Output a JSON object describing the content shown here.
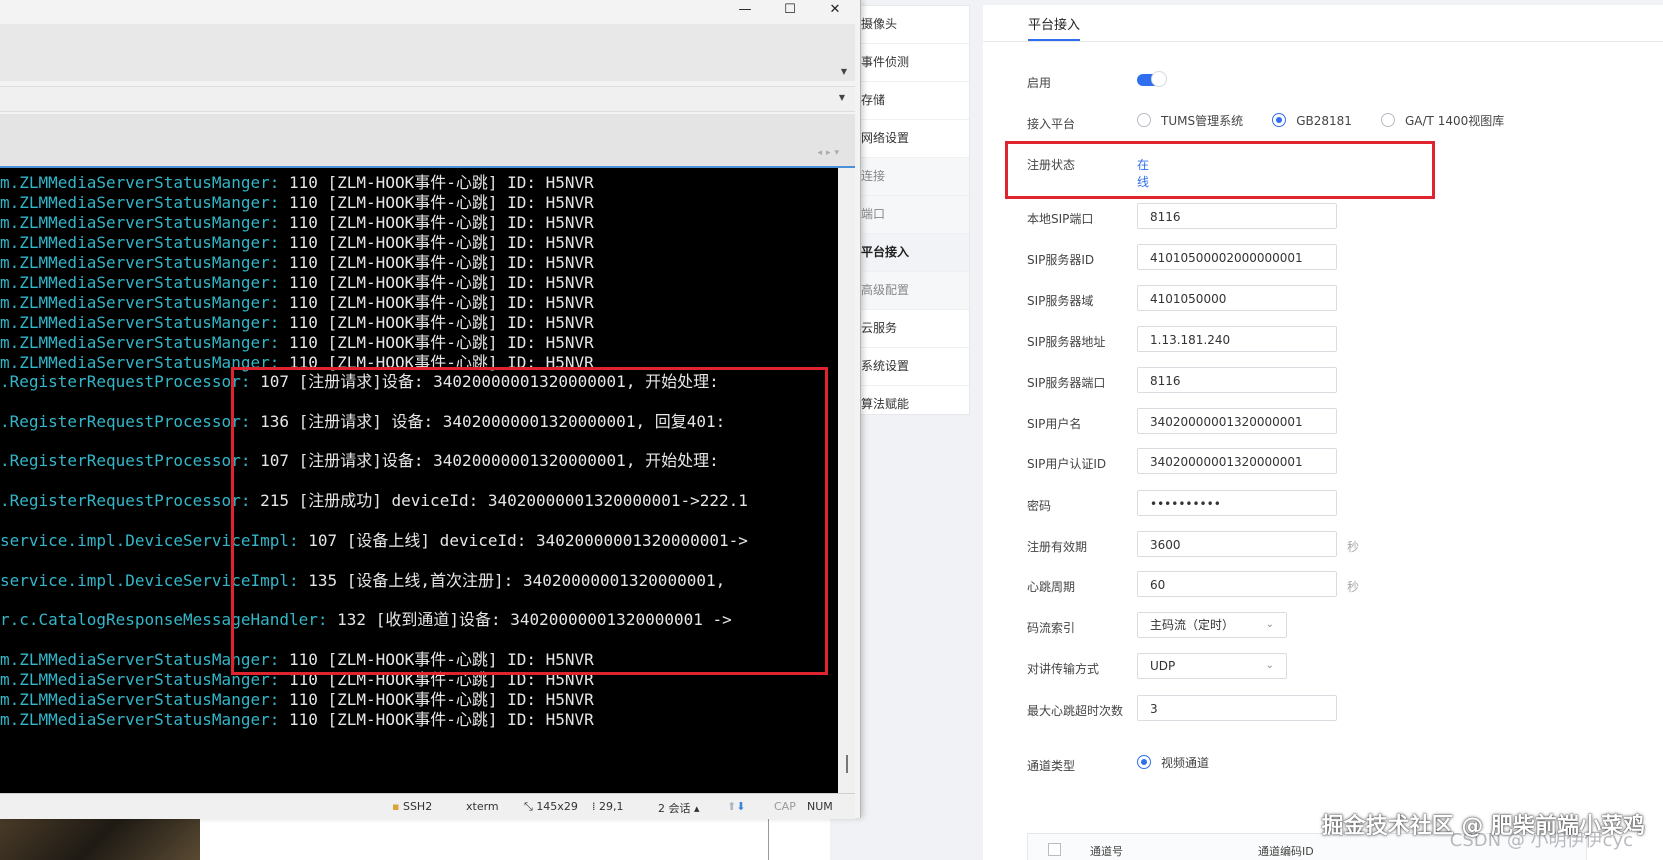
{
  "terminal": {
    "title_buttons": {
      "minimize": "—",
      "maximize": "☐",
      "close": "✕"
    },
    "lines": [
      {
        "source": "m.ZLMMediaServerStatusManger",
        "sep": ": ",
        "msg": "110 [ZLM-HOOK事件-心跳] ID: H5NVR"
      },
      {
        "source": "m.ZLMMediaServerStatusManger",
        "sep": ": ",
        "msg": "110 [ZLM-HOOK事件-心跳] ID: H5NVR"
      },
      {
        "source": "m.ZLMMediaServerStatusManger",
        "sep": ": ",
        "msg": "110 [ZLM-HOOK事件-心跳] ID: H5NVR"
      },
      {
        "source": "m.ZLMMediaServerStatusManger",
        "sep": ": ",
        "msg": "110 [ZLM-HOOK事件-心跳] ID: H5NVR"
      },
      {
        "source": "m.ZLMMediaServerStatusManger",
        "sep": ": ",
        "msg": "110 [ZLM-HOOK事件-心跳] ID: H5NVR"
      },
      {
        "source": "m.ZLMMediaServerStatusManger",
        "sep": ": ",
        "msg": "110 [ZLM-HOOK事件-心跳] ID: H5NVR"
      },
      {
        "source": "m.ZLMMediaServerStatusManger",
        "sep": ": ",
        "msg": "110 [ZLM-HOOK事件-心跳] ID: H5NVR"
      },
      {
        "source": "m.ZLMMediaServerStatusManger",
        "sep": ": ",
        "msg": "110 [ZLM-HOOK事件-心跳] ID: H5NVR"
      },
      {
        "source": "m.ZLMMediaServerStatusManger",
        "sep": ": ",
        "msg": "110 [ZLM-HOOK事件-心跳] ID: H5NVR"
      },
      {
        "source": "m.ZLMMediaServerStatusManger",
        "sep": ": ",
        "msg": "110 [ZLM-HOOK事件-心跳] ID: H5NVR"
      },
      {
        "source": ".RegisterRequestProcessor",
        "sep": ": ",
        "msg": "107 [注册请求]设备: 34020000001320000001, 开始处理:"
      },
      {
        "source": ".RegisterRequestProcessor",
        "sep": ": ",
        "msg": "136 [注册请求] 设备: 34020000001320000001, 回复401:"
      },
      {
        "source": ".RegisterRequestProcessor",
        "sep": ": ",
        "msg": "107 [注册请求]设备: 34020000001320000001, 开始处理:"
      },
      {
        "source": ".RegisterRequestProcessor",
        "sep": ": ",
        "msg": "215 [注册成功] deviceId: 34020000001320000001->222.1"
      },
      {
        "source": "service.impl.DeviceServiceImpl",
        "sep": ": ",
        "msg": "107 [设备上线] deviceId: 34020000001320000001->"
      },
      {
        "source": "service.impl.DeviceServiceImpl",
        "sep": ": ",
        "msg": "135 [设备上线,首次注册]: 34020000001320000001,"
      },
      {
        "source": "r.c.CatalogResponseMessageHandler",
        "sep": ": ",
        "msg": "132 [收到通道]设备: 34020000001320000001 ->"
      },
      {
        "source": "m.ZLMMediaServerStatusManger",
        "sep": ": ",
        "msg": "110 [ZLM-HOOK事件-心跳] ID: H5NVR"
      },
      {
        "source": "m.ZLMMediaServerStatusManger",
        "sep": ": ",
        "msg": "110 [ZLM-HOOK事件-心跳] ID: H5NVR"
      },
      {
        "source": "m.ZLMMediaServerStatusManger",
        "sep": ": ",
        "msg": "110 [ZLM-HOOK事件-心跳] ID: H5NVR"
      },
      {
        "source": "m.ZLMMediaServerStatusManger",
        "sep": ": ",
        "msg": "110 [ZLM-HOOK事件-心跳] ID: H5NVR"
      }
    ],
    "status_bar": {
      "protocol": "SSH2",
      "term": "xterm",
      "size": "145x29",
      "cursor": "29,1",
      "sessions": "2 会话",
      "caps": "CAP",
      "num": "NUM"
    }
  },
  "sidebar": {
    "items": [
      {
        "label": "摄像头",
        "kind": "item"
      },
      {
        "label": "事件侦测",
        "kind": "item"
      },
      {
        "label": "存储",
        "kind": "item"
      },
      {
        "label": "网络设置",
        "kind": "item"
      },
      {
        "label": "连接",
        "kind": "group"
      },
      {
        "label": "端口",
        "kind": "group"
      },
      {
        "label": "平台接入",
        "kind": "active"
      },
      {
        "label": "高级配置",
        "kind": "group"
      },
      {
        "label": "云服务",
        "kind": "item"
      },
      {
        "label": "系统设置",
        "kind": "item"
      },
      {
        "label": "算法赋能",
        "kind": "item"
      }
    ]
  },
  "platform": {
    "tab_label": "平台接入",
    "enable_label": "启用",
    "enabled": true,
    "access_platform_label": "接入平台",
    "platform_options": [
      "TUMS管理系统",
      "GB28181",
      "GA/T 1400视图库"
    ],
    "platform_selected": "GB28181",
    "reg_status_label": "注册状态",
    "reg_status_value": "在线",
    "fields": [
      {
        "label": "本地SIP端口",
        "value": "8116"
      },
      {
        "label": "SIP服务器ID",
        "value": "41010500002000000001"
      },
      {
        "label": "SIP服务器域",
        "value": "4101050000"
      },
      {
        "label": "SIP服务器地址",
        "value": "1.13.181.240"
      },
      {
        "label": "SIP服务器端口",
        "value": "8116"
      },
      {
        "label": "SIP用户名",
        "value": "34020000001320000001"
      },
      {
        "label": "SIP用户认证ID",
        "value": "34020000001320000001"
      },
      {
        "label": "密码",
        "value": "••••••••••"
      },
      {
        "label": "注册有效期",
        "value": "3600",
        "unit": "秒"
      },
      {
        "label": "心跳周期",
        "value": "60",
        "unit": "秒"
      }
    ],
    "stream_index_label": "码流索引",
    "stream_index_value": "主码流（定时）",
    "talk_transport_label": "对讲传输方式",
    "talk_transport_value": "UDP",
    "max_hb_timeout_label": "最大心跳超时次数",
    "max_hb_timeout_value": "3",
    "channel_type_label": "通道类型",
    "channel_type_value": "视频通道",
    "table_columns": [
      "通道号",
      "通道编码ID"
    ]
  },
  "watermark": "掘金技术社区 @ 肥柴前端小菜鸡",
  "watermark_faint": "CSDN @ 小明伊伊cyc",
  "colors": {
    "accent": "#2f6fed",
    "highlight_red": "#e0242f",
    "terminal_bg": "#000000",
    "terminal_source": "#33b6c8",
    "terminal_text": "#e6e6e6"
  }
}
